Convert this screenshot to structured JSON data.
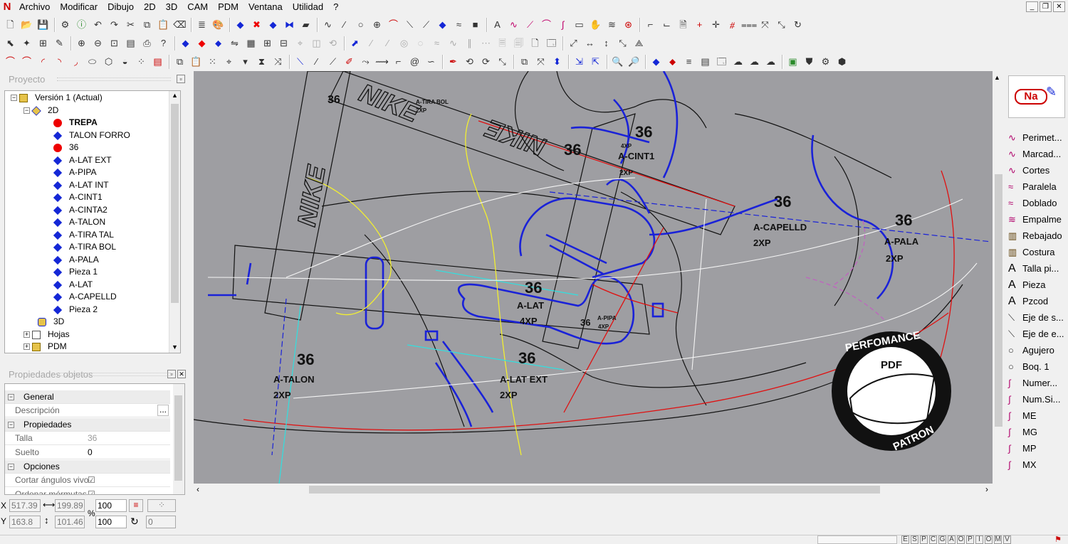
{
  "menu": {
    "items": [
      "Archivo",
      "Modificar",
      "Dibujo",
      "2D",
      "3D",
      "CAM",
      "PDM",
      "Ventana",
      "Utilidad",
      "?"
    ]
  },
  "project": {
    "title": "Proyecto",
    "tree": [
      {
        "label": "Versión 1 (Actual)",
        "level": 0,
        "icon": "version-icon"
      },
      {
        "label": "2D",
        "level": 1,
        "icon": "layers-2d-icon"
      },
      {
        "label": "TREPA",
        "level": 2,
        "icon": "red-dot-icon",
        "bold": true
      },
      {
        "label": "TALON FORRO",
        "level": 2,
        "icon": "blue-diamond-icon"
      },
      {
        "label": "36",
        "level": 2,
        "icon": "red-dot-icon"
      },
      {
        "label": "A-LAT EXT",
        "level": 2,
        "icon": "blue-diamond-icon"
      },
      {
        "label": "A-PIPA",
        "level": 2,
        "icon": "blue-diamond-icon"
      },
      {
        "label": "A-LAT INT",
        "level": 2,
        "icon": "blue-diamond-icon"
      },
      {
        "label": "A-CINT1",
        "level": 2,
        "icon": "blue-diamond-icon"
      },
      {
        "label": "A-CINTA2",
        "level": 2,
        "icon": "blue-diamond-icon"
      },
      {
        "label": "A-TALON",
        "level": 2,
        "icon": "blue-diamond-icon"
      },
      {
        "label": "A-TIRA TAL",
        "level": 2,
        "icon": "blue-diamond-icon"
      },
      {
        "label": "A-TIRA BOL",
        "level": 2,
        "icon": "blue-diamond-icon"
      },
      {
        "label": "A-PALA",
        "level": 2,
        "icon": "blue-diamond-icon"
      },
      {
        "label": "Pieza 1",
        "level": 2,
        "icon": "blue-diamond-icon"
      },
      {
        "label": "A-LAT",
        "level": 2,
        "icon": "blue-diamond-icon"
      },
      {
        "label": "A-CAPELLD",
        "level": 2,
        "icon": "blue-diamond-icon"
      },
      {
        "label": "Pieza 2",
        "level": 2,
        "icon": "blue-diamond-icon"
      },
      {
        "label": "3D",
        "level": 1,
        "icon": "3d-icon"
      },
      {
        "label": "Hojas",
        "level": 1,
        "icon": "sheets-icon"
      },
      {
        "label": "PDM",
        "level": 1,
        "icon": "folder-icon"
      }
    ]
  },
  "properties": {
    "title": "Propiedades objetos",
    "rows": [
      {
        "type": "header",
        "label": "General"
      },
      {
        "type": "row",
        "label": "Descripción",
        "value": "",
        "button": "..."
      },
      {
        "type": "header",
        "label": "Propiedades"
      },
      {
        "type": "row",
        "label": "Talla",
        "value": "36"
      },
      {
        "type": "row",
        "label": "Suelto",
        "value": "0"
      },
      {
        "type": "header",
        "label": "Opciones"
      },
      {
        "type": "row",
        "label": "Cortar ángulos vivo",
        "value": "☑"
      },
      {
        "type": "row",
        "label": "Ordenar mórmutas",
        "value": "☑"
      }
    ]
  },
  "canvas": {
    "labels": [
      {
        "text": "36",
        "size": "small"
      },
      {
        "text": "A-TIRA BOL",
        "size": "tiny"
      },
      {
        "text": "2XP",
        "size": "tiny"
      },
      {
        "text": "36",
        "size": "big"
      },
      {
        "text": "36",
        "size": "big"
      },
      {
        "text": "A-CINT1",
        "size": "mid"
      },
      {
        "text": "2XP",
        "size": "tiny"
      },
      {
        "text": "36",
        "size": "big"
      },
      {
        "text": "A-CAPELLD",
        "size": "mid"
      },
      {
        "text": "2XP",
        "size": "mid"
      },
      {
        "text": "36",
        "size": "big"
      },
      {
        "text": "A-PALA",
        "size": "mid"
      },
      {
        "text": "2XP",
        "size": "mid"
      },
      {
        "text": "36",
        "size": "big"
      },
      {
        "text": "A-LAT",
        "size": "mid"
      },
      {
        "text": "4XP",
        "size": "mid"
      },
      {
        "text": "36",
        "size": "small"
      },
      {
        "text": "A-PIPA",
        "size": "tiny"
      },
      {
        "text": "4XP",
        "size": "tiny"
      },
      {
        "text": "36",
        "size": "big"
      },
      {
        "text": "A-TALON",
        "size": "mid"
      },
      {
        "text": "2XP",
        "size": "mid"
      },
      {
        "text": "36",
        "size": "big"
      },
      {
        "text": "A-LAT EXT",
        "size": "mid"
      },
      {
        "text": "2XP",
        "size": "mid"
      },
      {
        "text": "NIKE",
        "size": "logo"
      },
      {
        "text": "NIKE",
        "size": "logo"
      },
      {
        "text": "NIKE",
        "size": "logo"
      },
      {
        "text": "4XP",
        "size": "tiny"
      }
    ],
    "watermark": {
      "top": "PERFOMANCE",
      "center": "PDF",
      "bottom": "PATRON"
    }
  },
  "tools": {
    "logo": "Na",
    "items": [
      "Perimet...",
      "Marcad...",
      "Cortes",
      "Paralela",
      "Doblado",
      "Empalme",
      "Rebajado",
      "Costura",
      "Talla pi...",
      "Pieza",
      "Pzcod",
      "Eje de s...",
      "Eje de e...",
      "Agujero",
      "Boq. 1",
      "Numer...",
      "Num.Si...",
      "ME",
      "MG",
      "MP",
      "MX"
    ]
  },
  "coords": {
    "x_label": "X",
    "x": "517.39",
    "w": "199.89",
    "y_label": "Y",
    "y": "163.8",
    "h": "101.46",
    "pct_label": "%",
    "zoom1": "100",
    "zoom2": "100",
    "angle": "0"
  },
  "snaps": [
    "E",
    "S",
    "P",
    "C",
    "G",
    "A",
    "O",
    "P",
    "I",
    "O",
    "M",
    "V"
  ]
}
